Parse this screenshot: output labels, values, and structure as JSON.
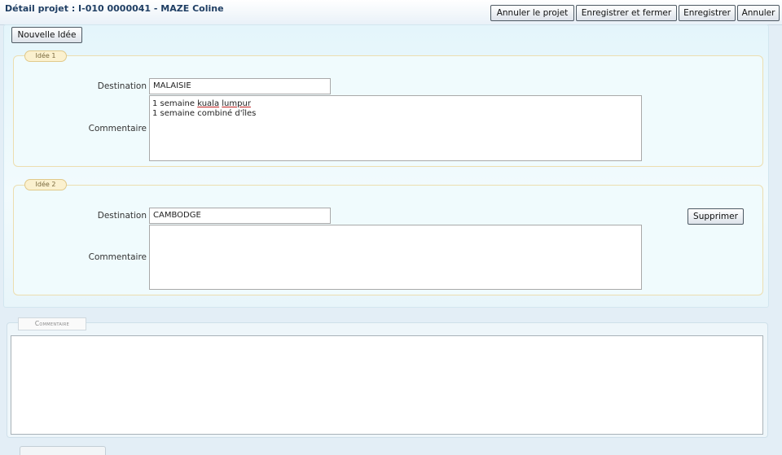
{
  "window": {
    "title": "Détail projet : I-010 0000041 - MAZE Coline"
  },
  "toolbar": {
    "cancel_project": "Annuler le projet",
    "save_close": "Enregistrer et fermer",
    "save": "Enregistrer",
    "cancel": "Annuler"
  },
  "new_idea_label": "Nouvelle Idée",
  "ideas": [
    {
      "legend": "Idée 1",
      "destination_label": "Destination",
      "destination": "MALAISIE",
      "comment_label": "Commentaire",
      "comment_lines": [
        "1 semaine ",
        "kuala",
        " ",
        "lumpur",
        "\n1 semaine combiné d'îles"
      ]
    },
    {
      "legend": "Idée 2",
      "destination_label": "Destination",
      "destination": "CAMBODGE",
      "comment_label": "Commentaire",
      "delete_label": "Supprimer"
    }
  ],
  "comment_section": {
    "legend": "Commentaire"
  }
}
